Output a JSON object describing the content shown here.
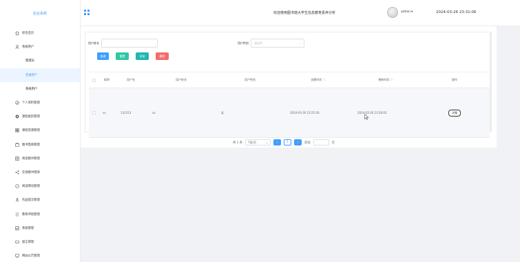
{
  "sidebar": {
    "brand": "后台系统",
    "items": [
      {
        "label": "综合首页",
        "icon": "home-icon",
        "type": "top"
      },
      {
        "label": "系统用户",
        "icon": "user-icon",
        "type": "top"
      },
      {
        "label": "管理员",
        "type": "sub"
      },
      {
        "label": "普通用户",
        "type": "sub",
        "active": true
      },
      {
        "label": "系统用户",
        "type": "sub"
      },
      {
        "label": "个人资料管理",
        "icon": "profile-icon",
        "type": "top"
      },
      {
        "label": "课程类别管理",
        "icon": "gear-icon",
        "type": "top"
      },
      {
        "label": "课程资源管理",
        "icon": "book-icon",
        "type": "top"
      },
      {
        "label": "图书借阅管理",
        "icon": "library-icon",
        "type": "top"
      },
      {
        "label": "阅读图书管理",
        "icon": "grid-icon",
        "type": "top"
      },
      {
        "label": "在线图书借阅",
        "icon": "share-icon",
        "type": "top"
      },
      {
        "label": "阅读情况管理",
        "icon": "chat-icon",
        "type": "top"
      },
      {
        "label": "作品提交管理",
        "icon": "person-icon",
        "type": "top"
      },
      {
        "label": "教育评估管理",
        "icon": "list-icon",
        "type": "top"
      },
      {
        "label": "系统管理",
        "icon": "image-icon",
        "type": "top"
      },
      {
        "label": "留言管理",
        "icon": "message-icon",
        "type": "top"
      },
      {
        "label": "网站公告管理",
        "icon": "monitor-icon",
        "type": "top"
      }
    ]
  },
  "header": {
    "title": "欢迎使用图书馆大学生信息教育素养分析",
    "user": "admin",
    "datetime": "2024-03-26 23:31:06"
  },
  "search": {
    "username_label": "用户姓名",
    "gender_label": "用户性别",
    "gender_placeholder": "请选择"
  },
  "buttons": {
    "search": "查询",
    "reset": "重置",
    "add": "添加",
    "delete": "删除"
  },
  "table": {
    "columns": [
      "昵称",
      "用户名",
      "用户姓名",
      "用户性别",
      "创建时间",
      "更新时间",
      "操作"
    ],
    "rows": [
      {
        "nickname": "xx",
        "username": "131313",
        "realname": "xx",
        "gender": "女",
        "created": "2024-03-26 23:25:30",
        "updated": "2024-03-26 23:26:02",
        "action": "详情"
      }
    ]
  },
  "pager": {
    "total": "共 1 条",
    "page_size": "7条/页",
    "prev": "‹",
    "current": "1",
    "next": "›",
    "goto_label": "前往",
    "page_unit": "页"
  }
}
